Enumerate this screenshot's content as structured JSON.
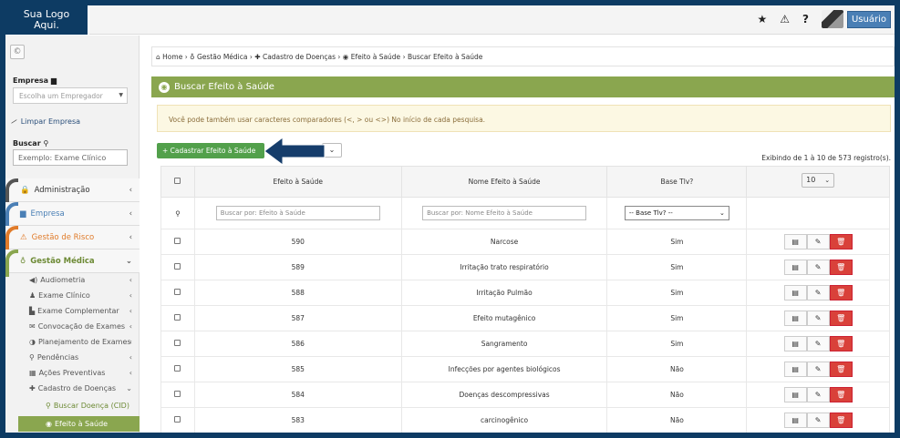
{
  "header": {
    "logo_line1": "Sua Logo",
    "logo_line2": "Aqui.",
    "icons": [
      "star-icon",
      "warning-icon",
      "help-icon"
    ],
    "user_label": "Usuário"
  },
  "sidebar": {
    "toggle_icon": "circle-arrow-left-icon",
    "empresa_label": "Empresa",
    "empresa_placeholder": "Escolha um Empregador",
    "clear_label": "Limpar Empresa",
    "search_label": "Buscar",
    "search_placeholder": "Exemplo: Exame Clínico",
    "menus": [
      {
        "label": "Administração",
        "color": "#555555"
      },
      {
        "label": "Empresa",
        "color": "#4a7fb5"
      },
      {
        "label": "Gestão de Risco",
        "color": "#e07b2a"
      },
      {
        "label": "Gestão Médica",
        "color": "#8aa64f"
      }
    ],
    "submenu": [
      {
        "label": "Audiometria"
      },
      {
        "label": "Exame Clínico"
      },
      {
        "label": "Exame Complementar"
      },
      {
        "label": "Convocação de Exames"
      },
      {
        "label": "Planejamento de Exames"
      },
      {
        "label": "Pendências"
      },
      {
        "label": "Ações Preventivas"
      },
      {
        "label": "Cadastro de Doenças"
      }
    ],
    "subsub": [
      {
        "label": "Buscar Doença (CID)"
      },
      {
        "label": "Efeito à Saúde"
      }
    ]
  },
  "breadcrumb": {
    "home": "Home",
    "gestao": "Gestão Médica",
    "cadastro": "Cadastro de Doenças",
    "efeito": "Efeito à Saúde",
    "current": "Buscar Efeito à Saúde"
  },
  "panel": {
    "title": "Buscar Efeito à Saúde",
    "alert": "Você pode também usar caracteres comparadores (<, > ou <>) No início de cada pesquisa.",
    "add_button": "+ Cadastrar Efeito à Saúde",
    "info": "Exibindo de 1 à 10 de 573 registro(s).",
    "page_length": "10"
  },
  "table": {
    "headers": [
      "Efeito à Saúde",
      "Nome Efeito à Saúde",
      "Base Tlv?"
    ],
    "filters": {
      "efeito_placeholder": "Buscar por: Efeito à Saúde",
      "nome_placeholder": "Buscar por: Nome Efeito à Saúde",
      "base_selected": "-- Base Tlv? --"
    },
    "rows": [
      {
        "id": "590",
        "nome": "Narcose",
        "base": "Sim"
      },
      {
        "id": "589",
        "nome": "Irritação trato respiratório",
        "base": "Sim"
      },
      {
        "id": "588",
        "nome": "Irritação Pulmão",
        "base": "Sim"
      },
      {
        "id": "587",
        "nome": "Efeito mutagênico",
        "base": "Sim"
      },
      {
        "id": "586",
        "nome": "Sangramento",
        "base": "Sim"
      },
      {
        "id": "585",
        "nome": "Infecções por agentes biológicos",
        "base": "Não"
      },
      {
        "id": "584",
        "nome": "Doenças descompressivas",
        "base": "Não"
      },
      {
        "id": "583",
        "nome": "carcinogênico",
        "base": "Não"
      }
    ]
  }
}
